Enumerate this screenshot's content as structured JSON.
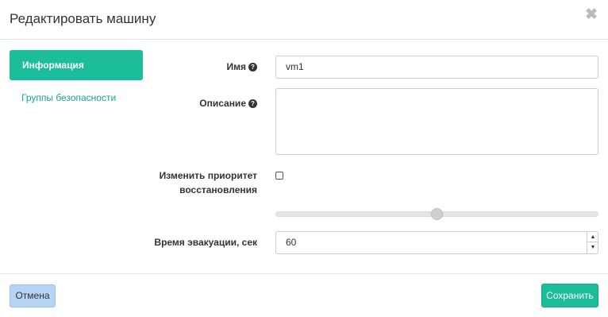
{
  "dialog": {
    "title": "Редактировать машину",
    "close_glyph": "✖"
  },
  "sidebar": {
    "items": [
      {
        "label": "Информация",
        "active": true
      },
      {
        "label": "Группы безопасности",
        "active": false
      }
    ]
  },
  "form": {
    "name": {
      "label": "Имя",
      "value": "vm1",
      "help_icon": "question-circle-icon"
    },
    "description": {
      "label": "Описание",
      "value": "",
      "help_icon": "question-circle-icon"
    },
    "priority": {
      "label_line1": "Изменить приоритет",
      "label_line2": "восстановления",
      "checked": false
    },
    "evacuation": {
      "label": "Время эвакуации, сек",
      "value": "60"
    }
  },
  "footer": {
    "cancel_label": "Отмена",
    "save_label": "Сохранить"
  },
  "colors": {
    "accent": "#1bbd9b",
    "cancel_bg": "#b8d4f5"
  }
}
